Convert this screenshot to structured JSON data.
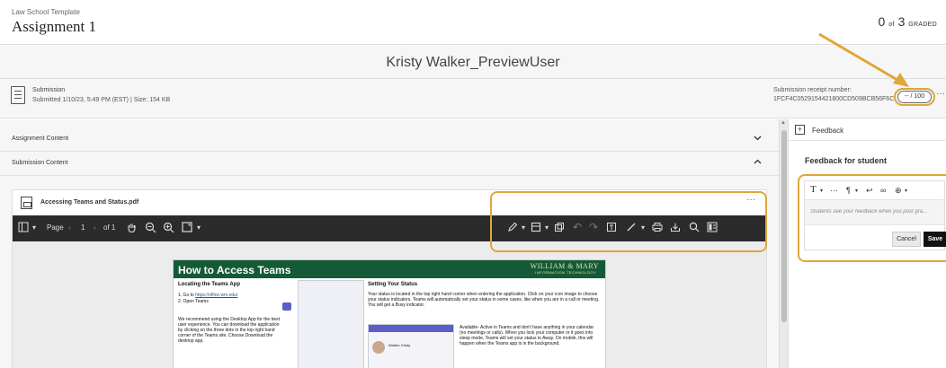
{
  "header": {
    "course_name": "Law School Template",
    "assignment_title": "Assignment 1",
    "graded_count": "0",
    "graded_of": "of",
    "graded_total": "3",
    "graded_label": "GRADED"
  },
  "student": {
    "name": "Kristy Walker_PreviewUser"
  },
  "submission": {
    "label": "Submission",
    "meta": "Submitted 1/10/23, 5:49 PM (EST) | Size: 154 KB",
    "receipt_label": "Submission receipt number:",
    "receipt_number": "1FCF4C0529154421800CD509BCB56F6C",
    "grade_input": "-- / 100",
    "more": "···"
  },
  "accordion": [
    {
      "label": "Assignment Content",
      "chevron": "chevron-down"
    },
    {
      "label": "Submission Content",
      "chevron": "chevron-up"
    }
  ],
  "file": {
    "name": "Accessing Teams and Status.pdf",
    "more": "···"
  },
  "viewer": {
    "page_label": "Page",
    "current_page": "1",
    "of_label": "of 1",
    "icons": [
      "sidebar-icon",
      "pan-icon",
      "zoom-out-icon",
      "zoom-in-icon",
      "fit-page-icon",
      "pen-icon",
      "stamp-icon",
      "copy-icon",
      "undo-icon",
      "redo-icon",
      "text-box-icon",
      "line-icon",
      "print-icon",
      "download-icon",
      "search-icon",
      "layout-icon"
    ]
  },
  "doc": {
    "title": "How to Access Teams",
    "wm_main": "WILLIAM & MARY",
    "wm_sub": "INFORMATION TECHNOLOGY",
    "col1_heading": "Locating the Teams App",
    "col1_step1": "1. Go to ",
    "col1_link": "https://office.wm.edu/",
    "col1_step2": "2. Open Teams",
    "col1_para": "We recommend using the Desktop App for the best user experience. You can download the application by clicking on the three dots in the top right hand corner of the Teams site. Choose Download the desktop app.",
    "col2_heading": "Setting Your Status",
    "col2_para": "Your status is located in the top right hand corner when entering the application. Click on your icon image to choose your status indicators. Teams will automatically set your status in some cases, like when you are in a call or meeting. You will get a Busy indicator.",
    "col2_avail": "Available- Active in Teams and don't have anything in your calendar (no meetings or calls). When you lock your computer or it goes into sleep mode, Teams will set your status to Away. On mobile, this will happen when the Teams app is in the background.",
    "col2_avail_bold": "Available",
    "shot_name": "Walker, Kristy"
  },
  "feedback": {
    "tab_label": "Feedback",
    "heading": "Feedback for student",
    "placeholder": "Students see your feedback when you post gra...",
    "cancel": "Cancel",
    "save": "Save",
    "toolbar": [
      "T",
      "···",
      "¶",
      "↩",
      "∞",
      "⊕"
    ]
  },
  "colors": {
    "highlight": "#e0a63a",
    "doc_green": "#155a36",
    "viewer_bg": "#2b2b2b"
  }
}
